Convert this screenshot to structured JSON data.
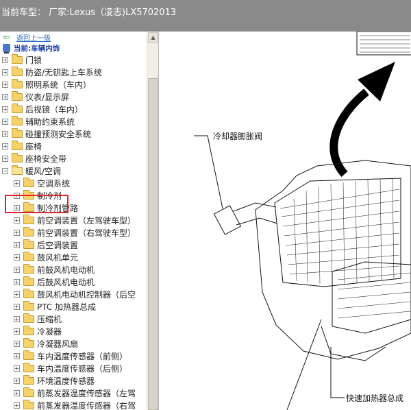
{
  "window": {
    "title": "当前车型： 厂家:Lexus（凌志)LX5702013"
  },
  "sidebar": {
    "back_label": "返回上一级",
    "current_label": "当前:车辆内饰",
    "top_items": [
      {
        "label": "门锁"
      },
      {
        "label": "防盗/无钥匙上车系统"
      },
      {
        "label": "照明系统（车内）"
      },
      {
        "label": "仪表/显示屏"
      },
      {
        "label": "后视镜（车内）"
      },
      {
        "label": "辅助约束系统"
      },
      {
        "label": "碰撞预测安全系统"
      },
      {
        "label": "座椅"
      },
      {
        "label": "座椅安全带"
      },
      {
        "label": "暖风/空调",
        "expanded": true,
        "highlighted": true
      }
    ],
    "sub_items": [
      {
        "label": "空调系统"
      },
      {
        "label": "制冷剂"
      },
      {
        "label": "制冷剂管路"
      },
      {
        "label": "前空调装置（左驾驶车型）"
      },
      {
        "label": "前空调装置（右驾驶车型）"
      },
      {
        "label": "后空调装置"
      },
      {
        "label": "鼓风机单元"
      },
      {
        "label": "前鼓风机电动机"
      },
      {
        "label": "后鼓风机电动机"
      },
      {
        "label": "鼓风机电动机控制器（后空"
      },
      {
        "label": "PTC 加热器总成"
      },
      {
        "label": "压缩机"
      },
      {
        "label": "冷凝器"
      },
      {
        "label": "冷凝器风扇"
      },
      {
        "label": "车内温度传感器（前侧）"
      },
      {
        "label": "车内温度传感器（后侧）"
      },
      {
        "label": "环境温度传感器"
      },
      {
        "label": "前蒸发器温度传感器（左驾"
      },
      {
        "label": "前蒸发器温度传感器（右驾"
      }
    ]
  },
  "diagram": {
    "callout_expansion_valve": "冷却器膨胀阀",
    "callout_heater": "快速加热器总成"
  },
  "colors": {
    "titlebar": "#8a8a8a",
    "highlight": "#e0262a",
    "link": "#2a6cc2"
  }
}
